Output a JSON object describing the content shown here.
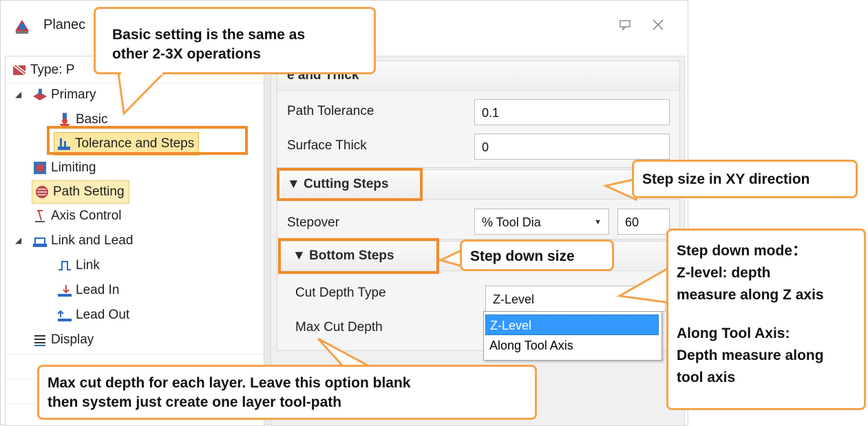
{
  "window": {
    "title": "Planec"
  },
  "tree": {
    "type_label": "Type: P",
    "items": [
      {
        "label": "Primary"
      },
      {
        "label": "Basic"
      },
      {
        "label": "Tolerance and Steps"
      },
      {
        "label": "Limiting"
      },
      {
        "label": "Path Setting"
      },
      {
        "label": "Axis Control"
      },
      {
        "label": "Link and Lead"
      },
      {
        "label": "Link"
      },
      {
        "label": "Lead In"
      },
      {
        "label": "Lead Out"
      },
      {
        "label": "Display"
      }
    ]
  },
  "panel": {
    "tolerance_header": "e and Thick",
    "path_tolerance": {
      "label": "Path Tolerance",
      "value": "0.1"
    },
    "surface_thick": {
      "label": "Surface Thick",
      "value": "0"
    },
    "cutting_steps_header": "▼ Cutting Steps",
    "stepover": {
      "label": "Stepover",
      "mode": "% Tool Dia",
      "value": "60"
    },
    "bottom_steps_header": "▼ Bottom Steps",
    "cut_depth_type": {
      "label": "Cut Depth Type",
      "value": "Z-Level",
      "options": [
        "Z-Level",
        "Along Tool Axis"
      ]
    },
    "max_cut_depth": {
      "label": "Max Cut Depth"
    }
  },
  "callouts": {
    "basic_setting": {
      "line1": "Basic setting is the same as",
      "line2": "other 2-3X operations"
    },
    "xy_step": "Step size in XY direction",
    "step_down": "Step down size",
    "step_down_mode": {
      "line1": "Step down mode：",
      "line2": "Z-level: depth",
      "line3": "measure along Z axis",
      "line4": "Along Tool Axis:",
      "line5": "Depth measure along",
      "line6": "tool axis"
    },
    "max_cut": {
      "line1": "Max cut depth for each layer. Leave this option blank",
      "line2": "then system just create one layer  tool-path"
    }
  },
  "colors": {
    "accent_orange": "#f08c2a",
    "selection_yellow": "#fbe7a1",
    "highlight_blue": "#3399ff"
  }
}
